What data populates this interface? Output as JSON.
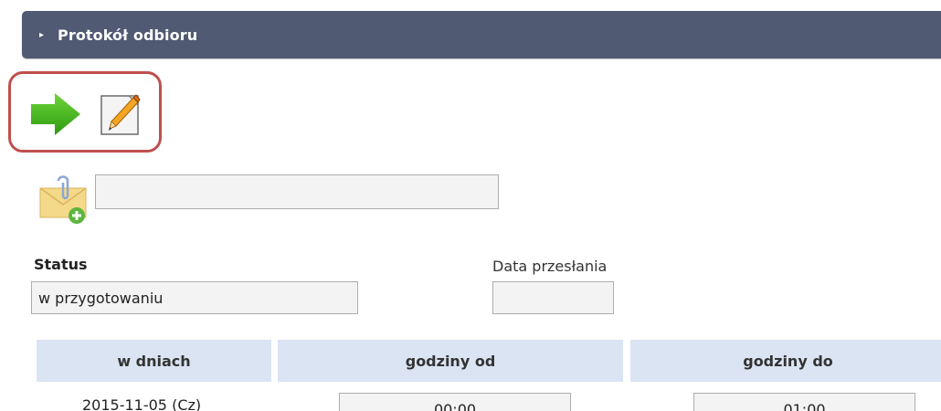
{
  "section": {
    "title": "Protokół odbioru",
    "expand_icon": "triangle-right-icon"
  },
  "toolbar": {
    "next_icon": "green-arrow-right-icon",
    "edit_icon": "pencil-document-icon",
    "highlight_color": "#c0504d"
  },
  "attachment": {
    "icon": "envelope-paperclip-add-icon",
    "value": ""
  },
  "status": {
    "label": "Status",
    "value": "w przygotowaniu"
  },
  "send_date": {
    "label": "Data przesłania",
    "value": ""
  },
  "table": {
    "headers": [
      "w dniach",
      "godziny od",
      "godziny do"
    ],
    "rows": [
      {
        "date": "2015-11-05 (Cz)",
        "from": "00:00",
        "to": "01:00"
      }
    ]
  },
  "colors": {
    "header_bg": "#505a73",
    "table_header_bg": "#dbe4f3",
    "field_bg": "#f3f3f3",
    "arrow_green": "#3cb21a"
  }
}
